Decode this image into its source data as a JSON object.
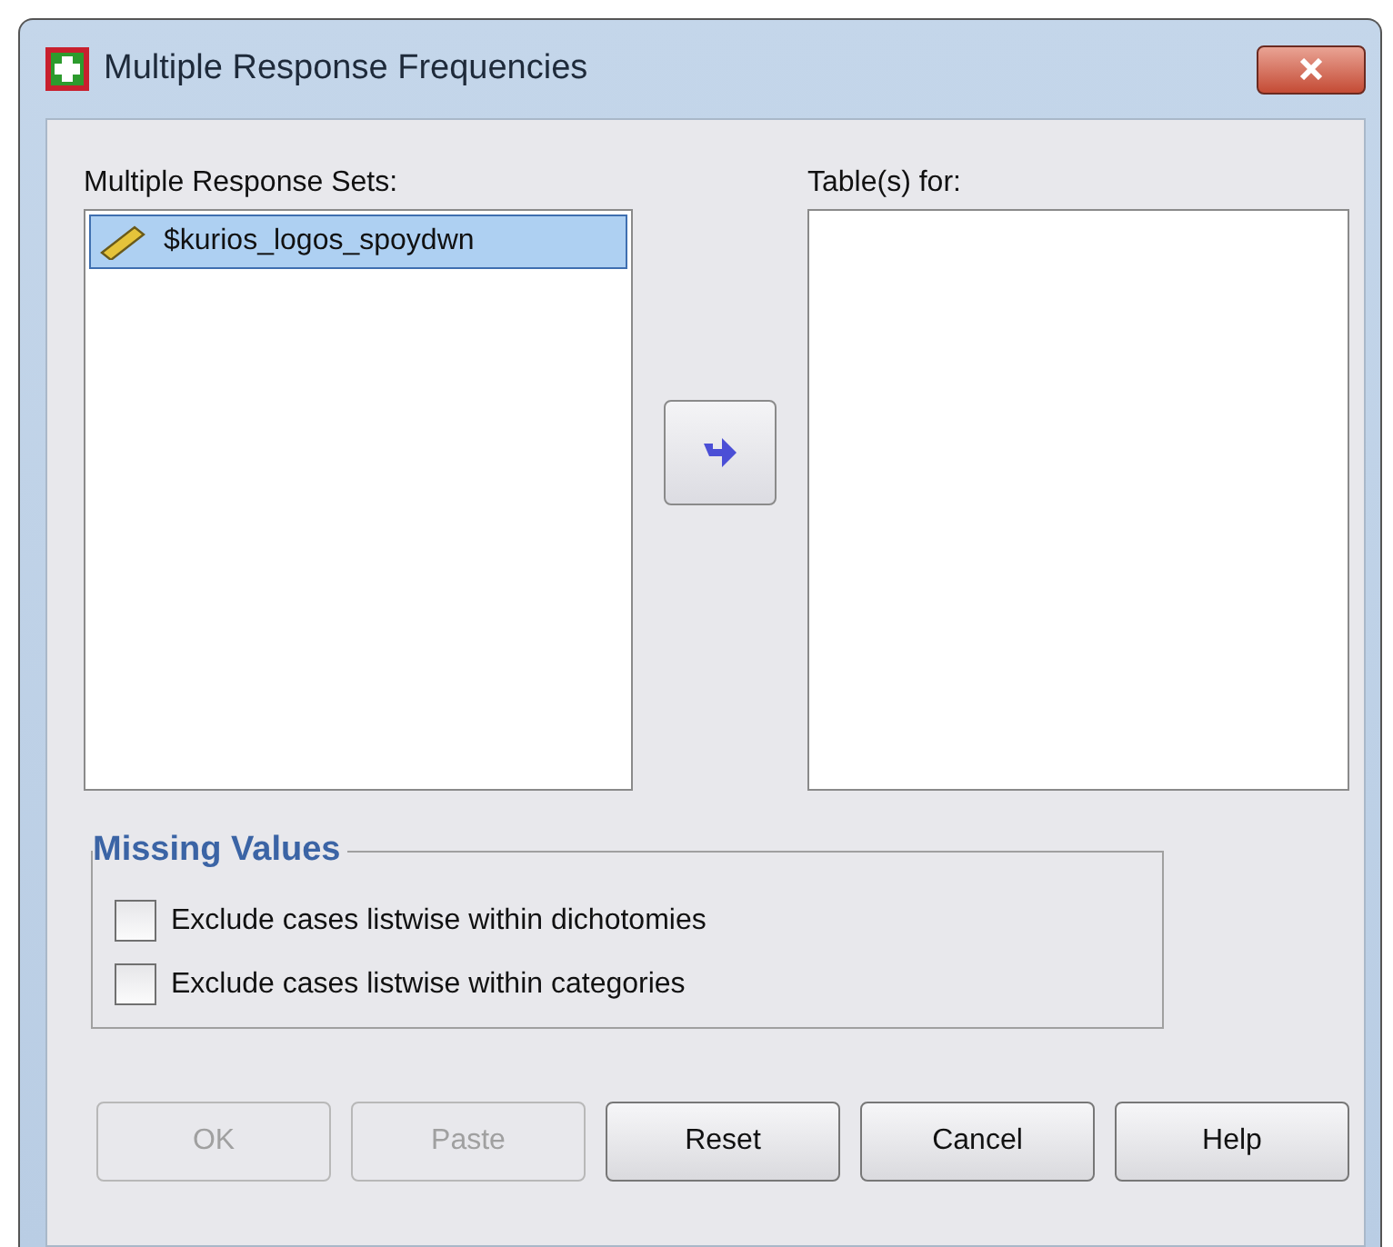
{
  "window": {
    "title": "Multiple Response Frequencies"
  },
  "source_list": {
    "label": "Multiple Response Sets:",
    "items": [
      {
        "label": "$kurios_logos_spoydwn",
        "selected": true
      }
    ]
  },
  "target_list": {
    "label": "Table(s) for:"
  },
  "missing_values": {
    "title": "Missing Values",
    "options": [
      {
        "label": "Exclude cases listwise within dichotomies",
        "checked": false
      },
      {
        "label": "Exclude cases listwise within categories",
        "checked": false
      }
    ]
  },
  "buttons": [
    {
      "label": "OK",
      "disabled": true
    },
    {
      "label": "Paste",
      "disabled": true
    },
    {
      "label": "Reset",
      "disabled": false
    },
    {
      "label": "Cancel",
      "disabled": false
    },
    {
      "label": "Help",
      "disabled": false
    }
  ]
}
